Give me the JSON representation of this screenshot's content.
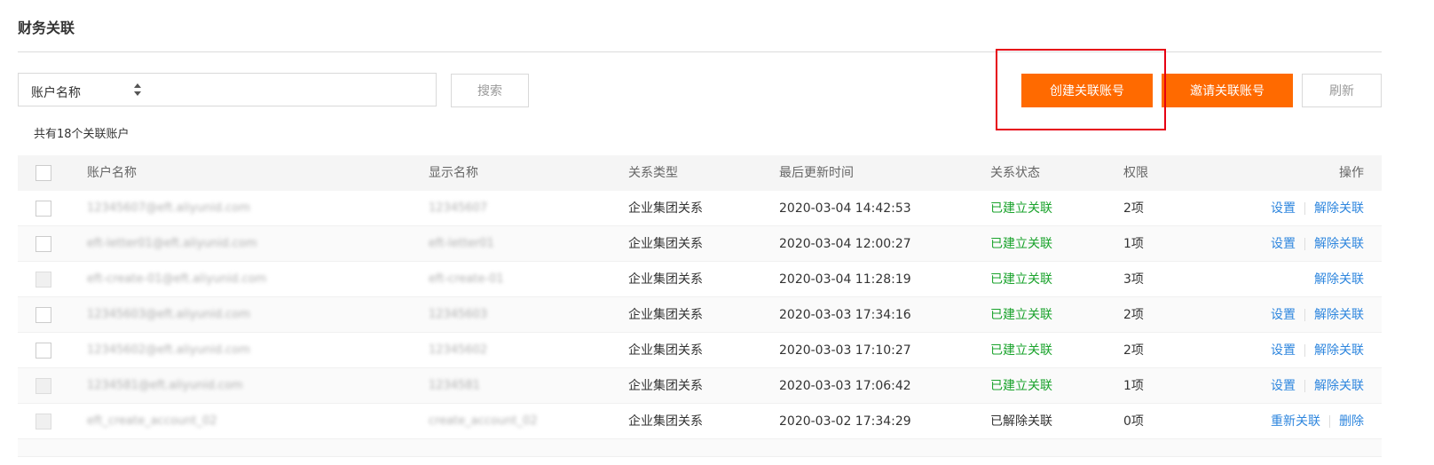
{
  "page": {
    "title": "财务关联"
  },
  "search": {
    "select_label": "账户名称",
    "input_value": "",
    "search_label": "搜索"
  },
  "actions": {
    "create_label": "创建关联账号",
    "invite_label": "邀请关联账号",
    "refresh_label": "刷新"
  },
  "summary": {
    "count_text": "共有18个关联账户"
  },
  "table": {
    "columns": [
      "账户名称",
      "显示名称",
      "关系类型",
      "最后更新时间",
      "关系状态",
      "权限",
      "操作"
    ],
    "rows": [
      {
        "account": "12345607@eft.aliyunid.com",
        "display": "12345607",
        "type": "企业集团关系",
        "time": "2020-03-04 14:42:53",
        "status": "已建立关联",
        "perm": "2项",
        "op1": "设置",
        "op2": "解除关联"
      },
      {
        "account": "eft-letter01@eft.aliyunid.com",
        "display": "eft-letter01",
        "type": "企业集团关系",
        "time": "2020-03-04 12:00:27",
        "status": "已建立关联",
        "perm": "1项",
        "op1": "设置",
        "op2": "解除关联"
      },
      {
        "account": "eft-create-01@eft.aliyunid.com",
        "display": "eft-create-01",
        "type": "企业集团关系",
        "time": "2020-03-04 11:28:19",
        "status": "已建立关联",
        "perm": "3项",
        "op1": "",
        "op2": "解除关联"
      },
      {
        "account": "12345603@eft.aliyunid.com",
        "display": "12345603",
        "type": "企业集团关系",
        "time": "2020-03-03 17:34:16",
        "status": "已建立关联",
        "perm": "2项",
        "op1": "设置",
        "op2": "解除关联"
      },
      {
        "account": "12345602@eft.aliyunid.com",
        "display": "12345602",
        "type": "企业集团关系",
        "time": "2020-03-03 17:10:27",
        "status": "已建立关联",
        "perm": "2项",
        "op1": "设置",
        "op2": "解除关联"
      },
      {
        "account": "1234581@eft.aliyunid.com",
        "display": "1234581",
        "type": "企业集团关系",
        "time": "2020-03-03 17:06:42",
        "status": "已建立关联",
        "perm": "1项",
        "op1": "设置",
        "op2": "解除关联"
      },
      {
        "account": "eft_create_account_02",
        "display": "create_account_02",
        "type": "企业集团关系",
        "time": "2020-03-02 17:34:29",
        "status": "已解除关联",
        "perm": "0项",
        "op1": "重新关联",
        "op2": "删除"
      }
    ]
  },
  "colors": {
    "primary": "#ff6a00",
    "status_ok": "#1aa32c",
    "link": "#2e86de",
    "highlight": "#e60012"
  }
}
